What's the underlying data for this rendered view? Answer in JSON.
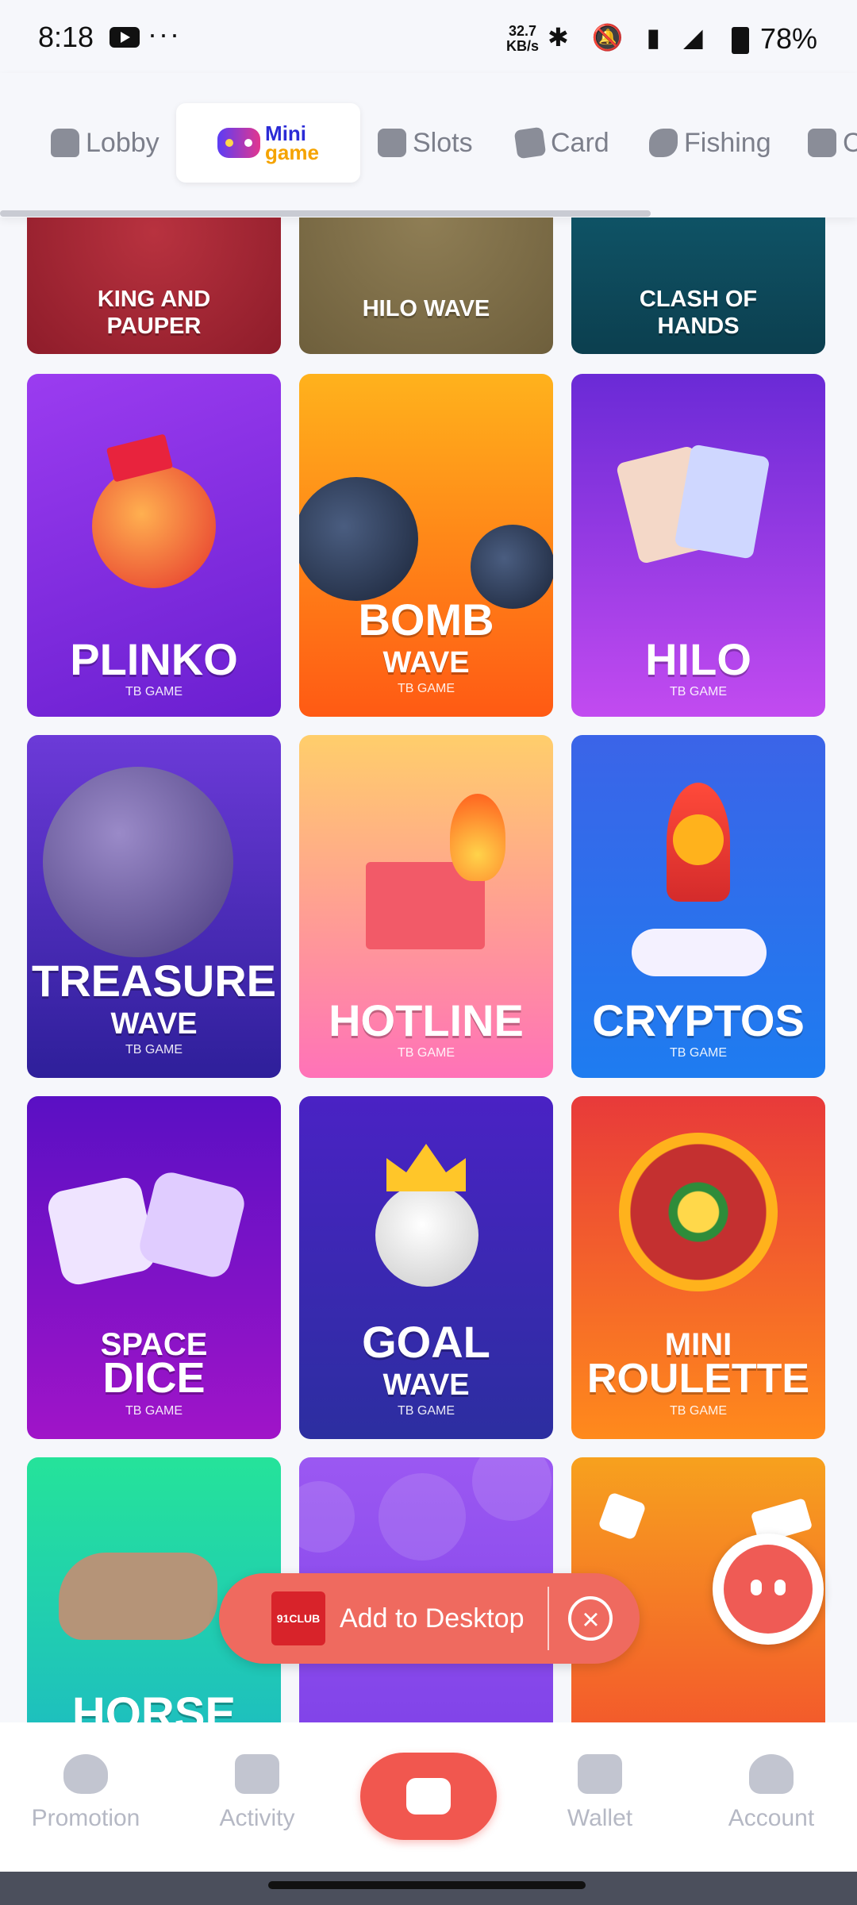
{
  "status_bar": {
    "time": "8:18",
    "speed_value": "32.7",
    "speed_unit": "KB/s",
    "battery": "78%"
  },
  "tabs": [
    {
      "label": "Lobby",
      "icon": "house-icon"
    },
    {
      "label_a": "Mini",
      "label_b": "game",
      "icon": "gamepad-icon"
    },
    {
      "label": "Slots",
      "icon": "slot-7-icon"
    },
    {
      "label": "Card",
      "icon": "card-icon"
    },
    {
      "label": "Fishing",
      "icon": "fish-icon"
    },
    {
      "label": "C",
      "icon": "casino-icon"
    }
  ],
  "games": [
    {
      "name": "KING AND PAUPER",
      "bg": "#9e2432"
    },
    {
      "name": "HILO WAVE",
      "bg": "#7a6a45"
    },
    {
      "name": "CLASH OF HANDS",
      "bg": "#0f4b5e"
    },
    {
      "line1": "PLINKO",
      "line2": "",
      "tag": "TB GAME",
      "bg": "#7b2ee0"
    },
    {
      "line1": "BOMB",
      "line2": "WAVE",
      "tag": "TB GAME",
      "bg": "#ff7a18"
    },
    {
      "line1": "HILO",
      "line2": "",
      "tag": "TB GAME",
      "bg": "#8a35e6"
    },
    {
      "line1": "TREASURE",
      "line2": "WAVE",
      "tag": "TB GAME",
      "bg": "#4c2fbf"
    },
    {
      "line1": "HOTLINE",
      "line2": "",
      "tag": "TB GAME",
      "bg": "#ff8db0"
    },
    {
      "line1": "CRYPTOS",
      "line2": "",
      "tag": "TB GAME",
      "bg": "#2d6ff2"
    },
    {
      "line1": "SPACE",
      "line2": "DICE",
      "tag": "TB GAME",
      "bg": "#7c12c8"
    },
    {
      "line1": "GOAL",
      "line2": "WAVE",
      "tag": "TB GAME",
      "bg": "#3a28b8"
    },
    {
      "line1": "MINI",
      "line2": "ROULETTE",
      "tag": "TB GAME",
      "bg": "#f0592f"
    },
    {
      "line1": "HORSE",
      "bg": "#22c59a"
    },
    {
      "line1": "",
      "bg": "#8a4df0"
    },
    {
      "line1": "",
      "bg": "#f08a20"
    }
  ],
  "add_to_desktop": {
    "logo_text": "91CLUB",
    "label": "Add to Desktop"
  },
  "bottom_nav": [
    {
      "label": "Promotion",
      "icon": "heart-hand-icon"
    },
    {
      "label": "Activity",
      "icon": "gift-icon"
    },
    {
      "label": "",
      "icon": "gamepad-icon"
    },
    {
      "label": "Wallet",
      "icon": "wallet-icon"
    },
    {
      "label": "Account",
      "icon": "user-icon"
    }
  ]
}
